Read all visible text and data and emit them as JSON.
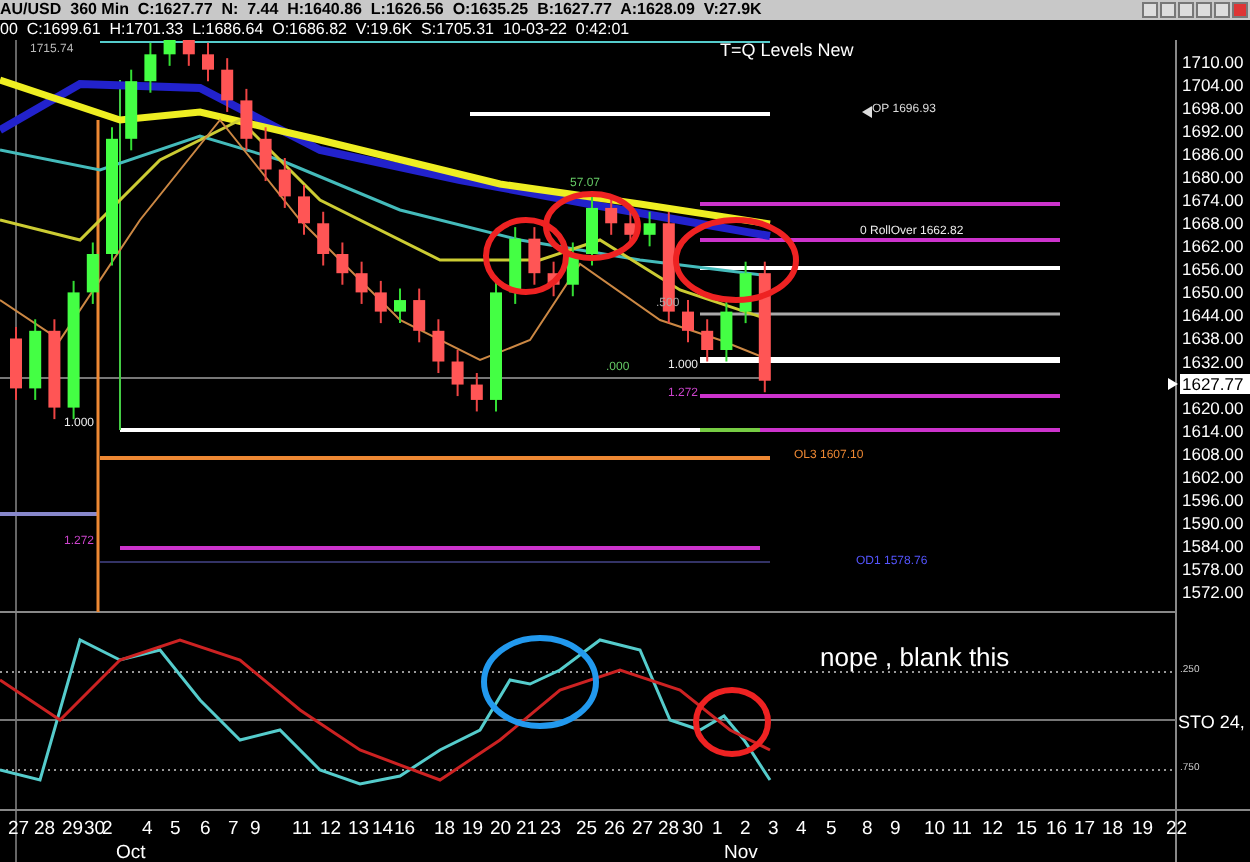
{
  "header": {
    "quote": "AU/USD  360 Min  C:1627.77  N:  7.44  H:1640.86  L:1626.56  O:1635.25  B:1627.77  A:1628.09  V:27.9K",
    "bar_info": "00  C:1699.61  H:1701.33  L:1686.64  O:1686.82  V:19.6K  S:1705.31  10-03-22  0:42:01"
  },
  "chart": {
    "title": "T=Q Levels New",
    "current_price": "1627.77",
    "price_axis": [
      "1710.00",
      "1704.00",
      "1698.00",
      "1692.00",
      "1686.00",
      "1680.00",
      "1674.00",
      "1668.00",
      "1662.00",
      "1656.00",
      "1650.00",
      "1644.00",
      "1638.00",
      "1632.00",
      "1620.00",
      "1614.00",
      "1608.00",
      "1602.00",
      "1596.00",
      "1590.00",
      "1584.00",
      "1578.00",
      "1572.00"
    ],
    "level_labels": [
      "1715.74",
      "OP 1696.93",
      "57.07",
      "0 RollOver 1662.82",
      ".500",
      ".000",
      "1.000",
      "1.272",
      "1.000",
      "OL3 1607.10",
      "1.272",
      "OD1 1578.76"
    ]
  },
  "oscillator": {
    "note": "nope , blank this",
    "axis": [
      ".250",
      ".750"
    ],
    "indicator": "STO  24,"
  },
  "date_axis": {
    "days": [
      "27",
      "28",
      "29",
      "30",
      "2",
      "4",
      "5",
      "6",
      "7",
      "9",
      "11",
      "12",
      "13",
      "14",
      "16",
      "18",
      "19",
      "20",
      "21",
      "23",
      "25",
      "26",
      "27",
      "28",
      "30",
      "1",
      "2",
      "3",
      "4",
      "5",
      "8",
      "9",
      "10",
      "11",
      "12",
      "15",
      "16",
      "17",
      "18",
      "19",
      "22"
    ],
    "months": [
      "Oct",
      "Nov"
    ]
  }
}
